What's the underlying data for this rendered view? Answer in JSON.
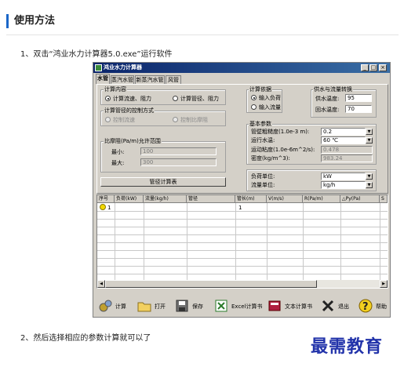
{
  "section_title": "使用方法",
  "step1": "1、双击“鸿业水力计算器5.0.exe”运行软件",
  "step2": "2、然后选择相应的参数计算就可以了",
  "watermark": "最需教育",
  "window": {
    "title": "鸿业水力计算器",
    "tabs": [
      "水管",
      "蒸汽水管",
      "新蒸汽水管",
      "风管"
    ],
    "calc_content": {
      "legend": "计算内容",
      "opt1": "计算流速、阻力",
      "opt2": "计算管径、阻力"
    },
    "pipe_method": {
      "legend": "计算管径的控制方式",
      "opt1": "控制流速",
      "opt2": "控制比摩阻"
    },
    "friction": {
      "legend": "比摩阻(Pa/m)允许范围",
      "min_label": "最小:",
      "min_value": "100",
      "max_label": "最大:",
      "max_value": "300"
    },
    "calc_button": "管径计算表",
    "basis": {
      "legend": "计算依据",
      "opt1": "输入负荷",
      "opt2": "输入流量"
    },
    "supply": {
      "legend": "供水与流量转换",
      "supply_label": "供水温度:",
      "supply_value": "95",
      "return_label": "回水温度:",
      "return_value": "70"
    },
    "params": {
      "legend": "基本参数",
      "roughness_label": "管壁粗糙度(1.0e-3 m):",
      "roughness_value": "0.2",
      "temp_label": "运行水温:",
      "temp_value": "60 ℃",
      "viscosity_label": "运动粘度(1.0e-6m^2/s):",
      "viscosity_value": "0.478",
      "density_label": "密度(kg/m^3):",
      "density_value": "983.24"
    },
    "units": {
      "load_label": "负荷单位:",
      "load_value": "kW",
      "flow_label": "流量单位:",
      "flow_value": "kg/h"
    },
    "grid_headers": [
      "序号",
      "负荷(kW)",
      "流量(kg/h)",
      "管径",
      "管长(m)",
      "V(m/s)",
      "R(Pa/m)",
      "△Py(Pa)",
      "S"
    ],
    "grid_row": {
      "index": "1",
      "length": "1"
    },
    "toolbar": [
      "计算",
      "打开",
      "保存",
      "Excel计算书",
      "文本计算书",
      "退出",
      "帮助"
    ]
  }
}
